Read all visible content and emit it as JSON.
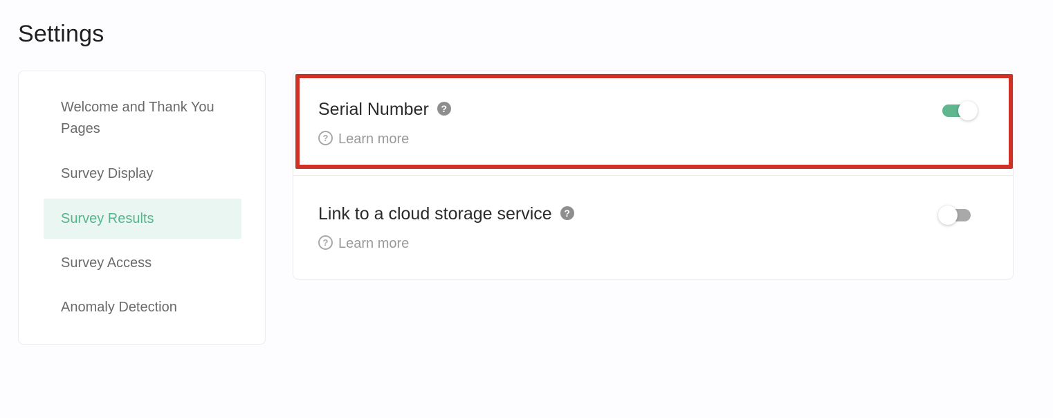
{
  "page": {
    "title": "Settings"
  },
  "sidebar": {
    "items": [
      {
        "label": "Welcome and Thank You Pages",
        "active": false
      },
      {
        "label": "Survey Display",
        "active": false
      },
      {
        "label": "Survey Results",
        "active": true
      },
      {
        "label": "Survey Access",
        "active": false
      },
      {
        "label": "Anomaly Detection",
        "active": false
      }
    ]
  },
  "settings": [
    {
      "title": "Serial Number",
      "help_icon": "question-mark-icon",
      "learn_more": "Learn more",
      "enabled": true,
      "highlighted": true
    },
    {
      "title": "Link to a cloud storage service",
      "help_icon": "question-mark-icon",
      "learn_more": "Learn more",
      "enabled": false,
      "highlighted": false
    }
  ],
  "colors": {
    "accent": "#5fb68f",
    "active_bg": "#eaf6f1",
    "highlight_border": "#cf3127",
    "toggle_off": "#a9a9a9"
  }
}
